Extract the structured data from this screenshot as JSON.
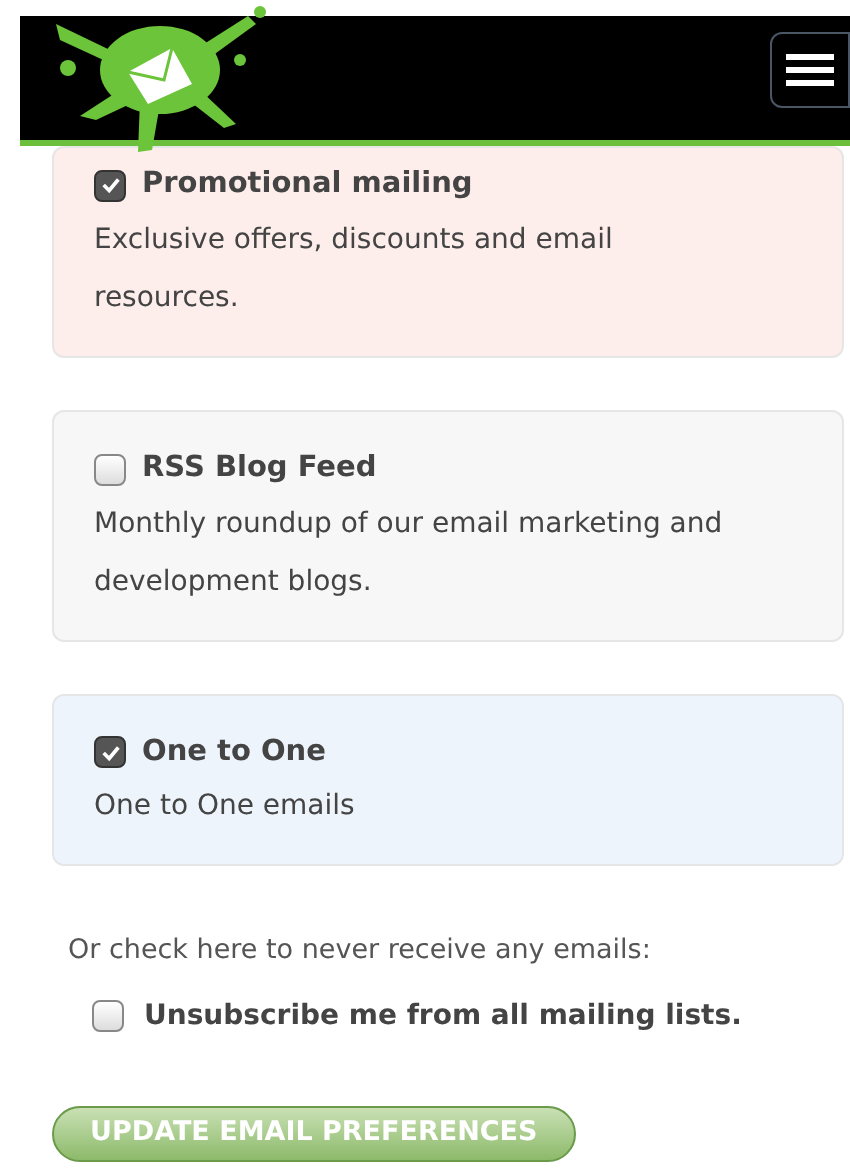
{
  "lists": [
    {
      "title": "Promotional mailing",
      "description": "Exclusive offers, discounts and email resources.",
      "checked": true,
      "color": "#fdeeec"
    },
    {
      "title": "RSS Blog Feed",
      "description": "Monthly roundup of our email marketing and development blogs.",
      "checked": false,
      "color": "#f7f7f7"
    },
    {
      "title": "One to One",
      "description": "One to One emails",
      "checked": true,
      "color": "#eef4fb"
    }
  ],
  "unsubscribe": {
    "prompt": "Or check here to never receive any emails:",
    "label": "Unsubscribe me from all mailing lists.",
    "checked": false
  },
  "submit_button": "UPDATE EMAIL PREFERENCES"
}
